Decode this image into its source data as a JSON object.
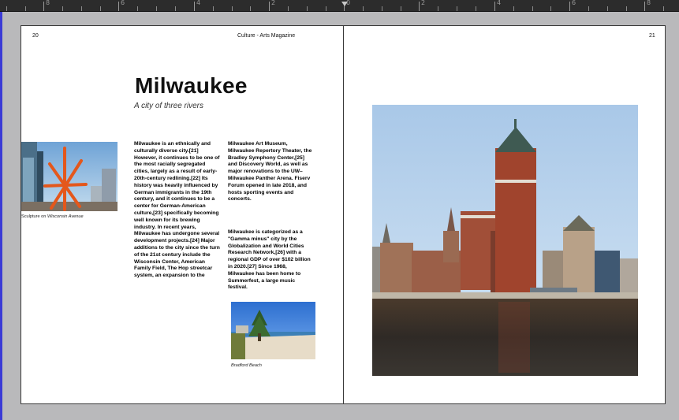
{
  "ruler": {
    "labels": [
      "8",
      "6",
      "4",
      "2",
      "0",
      "2",
      "4",
      "6",
      "8"
    ]
  },
  "spread": {
    "left_page_number": "20",
    "right_page_number": "21",
    "running_head": "Culture - Arts Magazine"
  },
  "article": {
    "title": "Milwaukee",
    "subtitle": "A city of three rivers",
    "column1": "Milwaukee is an ethnically and culturally diverse city.[21] However, it continues to be one of the most racially segregated cities, largely as a result of early-20th-century redlining.[22] Its history was heavily influenced by German immigrants in the 19th century, and it continues to be a center for German-American culture,[23] specifically becoming well known for its brewing industry. In recent years, Milwaukee has undergone several development projects.[24] Major additions to the city since the turn of the 21st century include the Wisconsin Center, American Family Field, The Hop streetcar system, an expansion to the",
    "column2a": "Milwaukee Art Museum, Milwaukee Repertory Theater, the Bradley Symphony Center,[25] and Discovery World, as well as major renovations to the UW–Milwaukee Panther Arena. Fiserv Forum opened in late 2018, and hosts sporting events and concerts.",
    "column2b": "Milwaukee is categorized as a \"Gamma minus\" city by the Globalization and World Cities Research Network,[26] with a regional GDP of over $102 billion in 2020.[27] Since 1968, Milwaukee has been home to Summerfest, a large music festival.",
    "caption_sculpture_prefix": "Sculpture on ",
    "caption_sculpture_place": "Wisconsin Avenue",
    "caption_beach": "Bradford Beach"
  },
  "colors": {
    "ruler_bg": "#2c2c2c",
    "pasteboard": "#b9b9bb",
    "page": "#ffffff",
    "guide_blue": "#3b3bd6"
  }
}
